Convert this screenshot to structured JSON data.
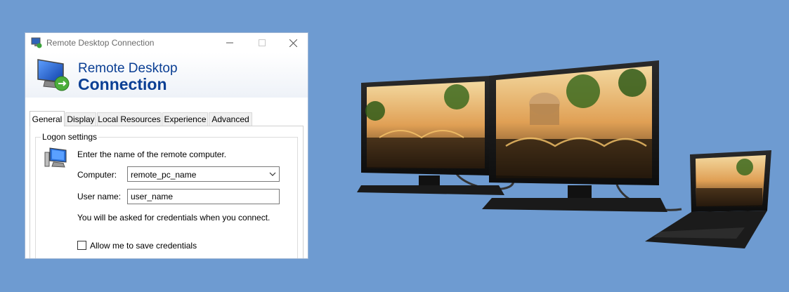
{
  "window": {
    "title": "Remote Desktop Connection",
    "banner_line1": "Remote Desktop",
    "banner_line2": "Connection"
  },
  "tabs": [
    {
      "label": "General",
      "active": true
    },
    {
      "label": "Display",
      "active": false
    },
    {
      "label": "Local Resources",
      "active": false
    },
    {
      "label": "Experience",
      "active": false
    },
    {
      "label": "Advanced",
      "active": false
    }
  ],
  "logon": {
    "group_label": "Logon settings",
    "instruction": "Enter the name of the remote computer.",
    "computer_label": "Computer:",
    "computer_value": "remote_pc_name",
    "user_label": "User name:",
    "user_value": "user_name",
    "note": "You will be asked for credentials when you connect.",
    "save_credentials_label": "Allow me to save credentials",
    "save_credentials_checked": false
  },
  "colors": {
    "background": "#6e9bd1",
    "banner_text": "#0b3f94"
  },
  "icons": [
    "remote-desktop-app-icon",
    "remote-desktop-logo-icon",
    "computer-icon",
    "chevron-down-icon",
    "minimize-icon",
    "maximize-icon",
    "close-icon"
  ]
}
